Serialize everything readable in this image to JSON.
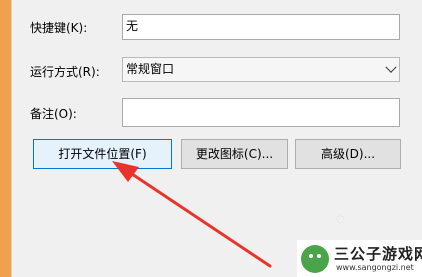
{
  "form": {
    "shortcut_label": "快捷键(K):",
    "shortcut_value": "无",
    "run_label": "运行方式(R):",
    "run_value": "常规窗口",
    "comment_label": "备注(O):",
    "comment_value": ""
  },
  "buttons": {
    "open_location": "打开文件位置(F)",
    "change_icon": "更改图标(C)...",
    "advanced": "高级(D)..."
  },
  "watermark": {
    "title": "三公子游戏网",
    "url": "www.sangongzi.net"
  },
  "colors": {
    "accent_orange": "#f1a14c",
    "arrow_red": "#e8352b",
    "focus_blue": "#0078d7"
  },
  "icons": {
    "dropdown": "chevron-down-icon",
    "annotation": "red-arrow-icon",
    "watermark_logo": "android-icon"
  }
}
